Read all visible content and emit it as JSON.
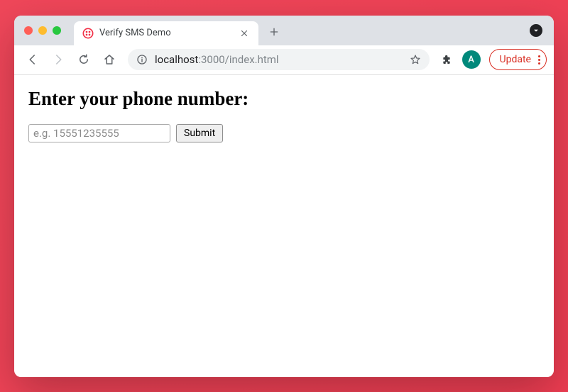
{
  "tab": {
    "title": "Verify SMS Demo"
  },
  "address": {
    "host": "localhost",
    "port_path": ":3000/index.html"
  },
  "toolbar": {
    "avatar_letter": "A",
    "update_label": "Update"
  },
  "page": {
    "heading": "Enter your phone number:",
    "phone_placeholder": "e.g. 15551235555",
    "submit_label": "Submit"
  }
}
